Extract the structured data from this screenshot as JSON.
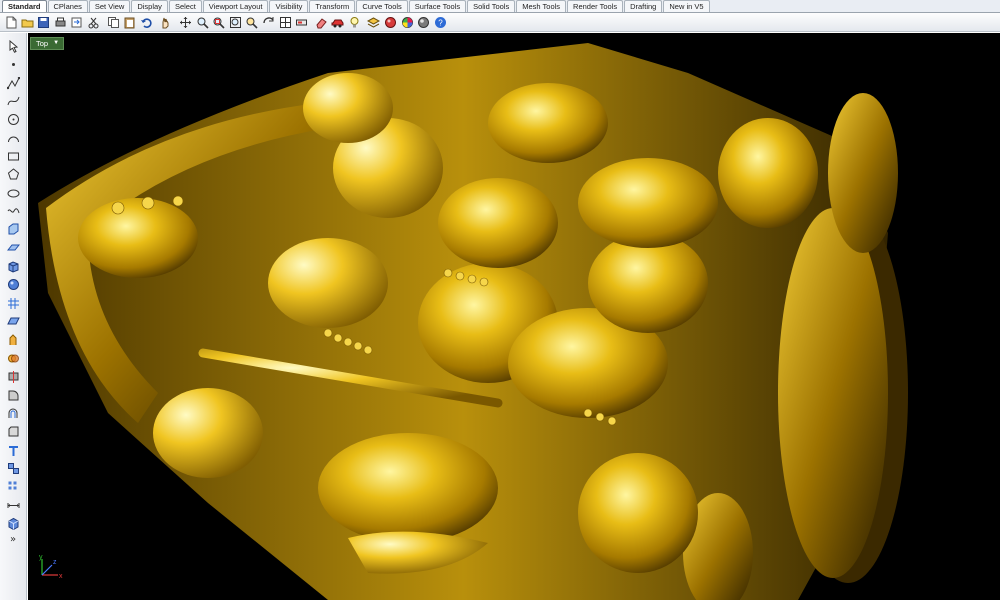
{
  "tabs": [
    "Standard",
    "CPlanes",
    "Set View",
    "Display",
    "Select",
    "Viewport Layout",
    "Visibility",
    "Transform",
    "Curve Tools",
    "Surface Tools",
    "Solid Tools",
    "Mesh Tools",
    "Render Tools",
    "Drafting",
    "New in V5"
  ],
  "active_tab": "Standard",
  "toolbar_icons": [
    "new-file-icon",
    "open-icon",
    "save-icon",
    "print-icon",
    "import-icon",
    "cut-icon",
    "copy-icon",
    "paste-icon",
    "undo-icon",
    "pan-hand-icon",
    "move-icon",
    "zoom-icon",
    "zoom-window-icon",
    "zoom-extents-icon",
    "zoom-selected-icon",
    "rotate-view-icon",
    "four-viewports-icon",
    "properties-icon",
    "eraser-icon",
    "car-icon",
    "lightbulb-icon",
    "layer-icon",
    "render-sphere-icon",
    "color-wheel-icon",
    "material-sphere-icon",
    "help-icon"
  ],
  "left_icons": [
    "select-arrow-icon",
    "point-icon",
    "polyline-icon",
    "curve-icon",
    "circle-icon",
    "arc-icon",
    "rectangle-icon",
    "polygon-icon",
    "ellipse-icon",
    "free-curve-icon",
    "surface-corner-icon",
    "surface-icon",
    "box-icon",
    "sphere-icon",
    "mesh-icon",
    "plane-icon",
    "extrude-icon",
    "boolean-icon",
    "split-icon",
    "fillet-icon",
    "offset-icon",
    "chamfer-icon",
    "text-icon",
    "group-icon",
    "array-icon",
    "dimension-icon",
    "solid-icon"
  ],
  "left_more_glyph": "»",
  "viewport": {
    "label": "Top",
    "caret": "▼",
    "axis_x": "x",
    "axis_y": "y",
    "axis_z": "z"
  },
  "colors": {
    "viewport_bg": "#000000",
    "model_gold": "#c99a05",
    "viewport_label_bg": "#3a6a33"
  }
}
